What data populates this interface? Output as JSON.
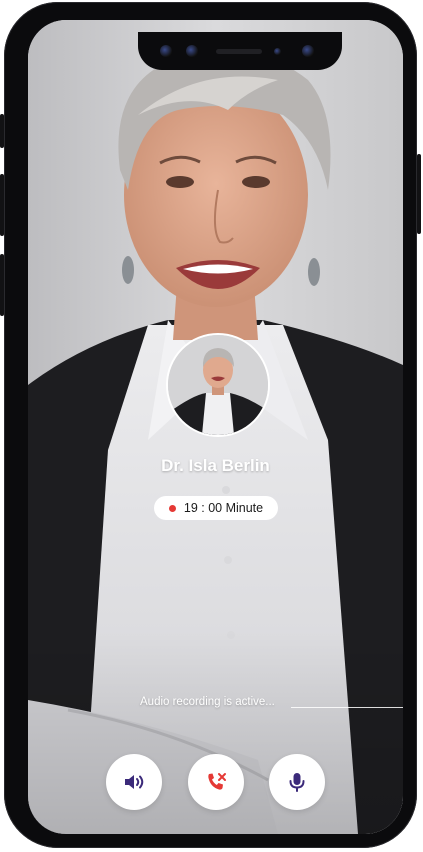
{
  "call": {
    "caller_name": "Dr. Isla Berlin",
    "duration": "19 : 00 Minute",
    "recording_status": "Audio recording is active..."
  },
  "controls": [
    {
      "icon": "speaker-icon",
      "color": "#3b2a7a"
    },
    {
      "icon": "end-call-icon",
      "color": "#e53935"
    },
    {
      "icon": "microphone-icon",
      "color": "#3b2a7a"
    }
  ],
  "colors": {
    "accent": "#3b2a7a",
    "danger": "#e53935",
    "pill": "#ffffff",
    "text_on_photo": "#ffffff"
  }
}
